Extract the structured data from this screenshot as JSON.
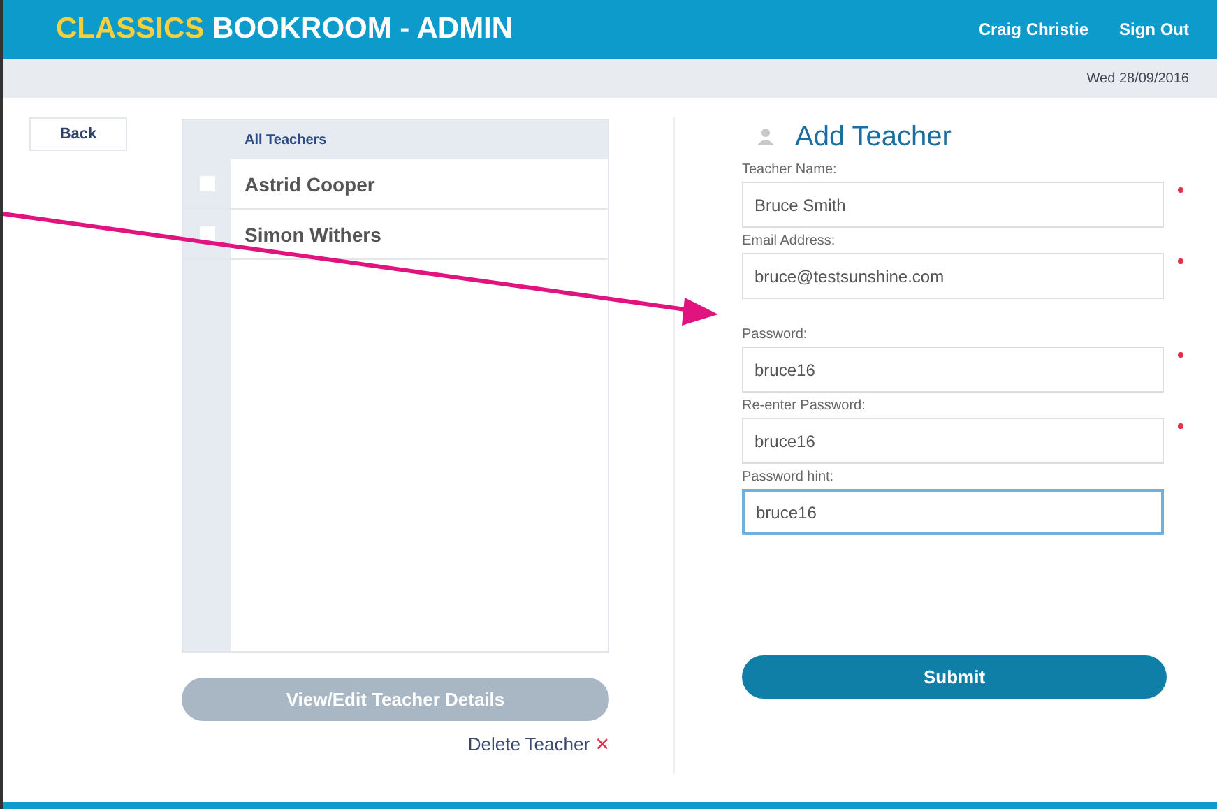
{
  "header": {
    "brand_highlight": "CLASSICS",
    "brand_rest": "BOOKROOM - ADMIN",
    "user": "Craig Christie",
    "sign_out": "Sign Out"
  },
  "date": "Wed 28/09/2016",
  "back": "Back",
  "teacher_list": {
    "heading": "All Teachers",
    "items": [
      {
        "name": "Astrid Cooper",
        "checked": false
      },
      {
        "name": "Simon Withers",
        "checked": false
      }
    ]
  },
  "view_button": {
    "label": "View/Edit Teacher Details",
    "disabled": true
  },
  "delete": {
    "label": "Delete Teacher",
    "icon": "×"
  },
  "form": {
    "title": "Add Teacher",
    "field_groups": [
      [
        {
          "label": "Teacher Name:",
          "value": "Bruce Smith",
          "required": true,
          "focused": false
        },
        {
          "label": "Email Address:",
          "value": "bruce@testsunshine.com",
          "required": true,
          "focused": false
        }
      ],
      [
        {
          "label": "Password:",
          "value": "bruce16",
          "required": true,
          "focused": false
        },
        {
          "label": "Re-enter Password:",
          "value": "bruce16",
          "required": true,
          "focused": false
        },
        {
          "label": "Password hint:",
          "value": "bruce16",
          "required": false,
          "focused": true
        }
      ]
    ],
    "submit": "Submit"
  }
}
